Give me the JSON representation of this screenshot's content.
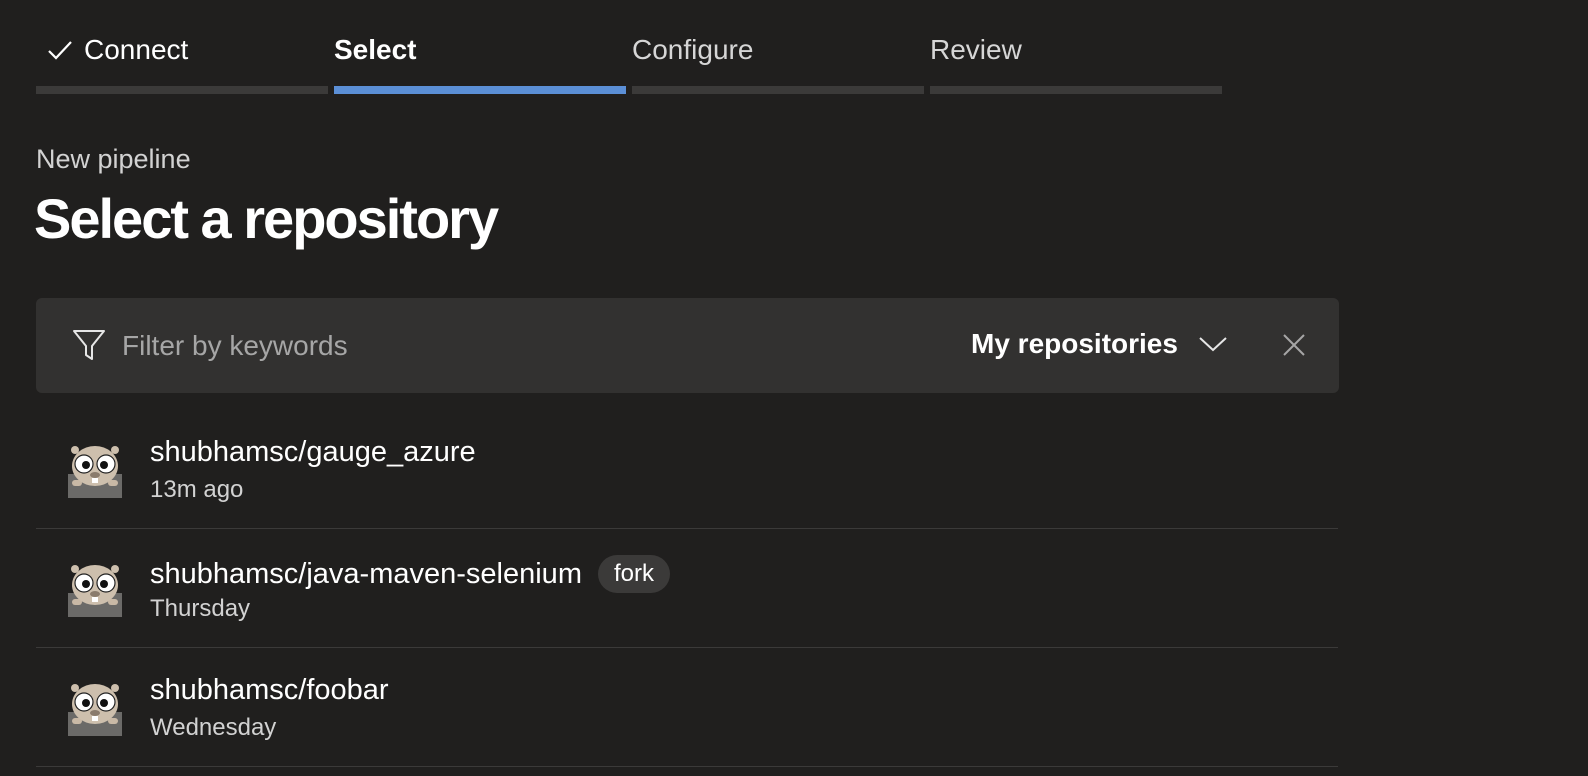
{
  "steps": [
    {
      "label": "Connect",
      "state": "done"
    },
    {
      "label": "Select",
      "state": "active"
    },
    {
      "label": "Configure",
      "state": "pending"
    },
    {
      "label": "Review",
      "state": "pending"
    }
  ],
  "header": {
    "subtitle": "New pipeline",
    "title": "Select a repository"
  },
  "filter": {
    "placeholder": "Filter by keywords",
    "scope": "My repositories"
  },
  "repos": [
    {
      "name": "shubhamsc/gauge_azure",
      "time": "13m ago",
      "badge": ""
    },
    {
      "name": "shubhamsc/java-maven-selenium",
      "time": "Thursday",
      "badge": "fork"
    },
    {
      "name": "shubhamsc/foobar",
      "time": "Wednesday",
      "badge": ""
    }
  ],
  "colors": {
    "background": "#201f1e",
    "panel": "#323130",
    "accent": "#5b8fd6"
  }
}
